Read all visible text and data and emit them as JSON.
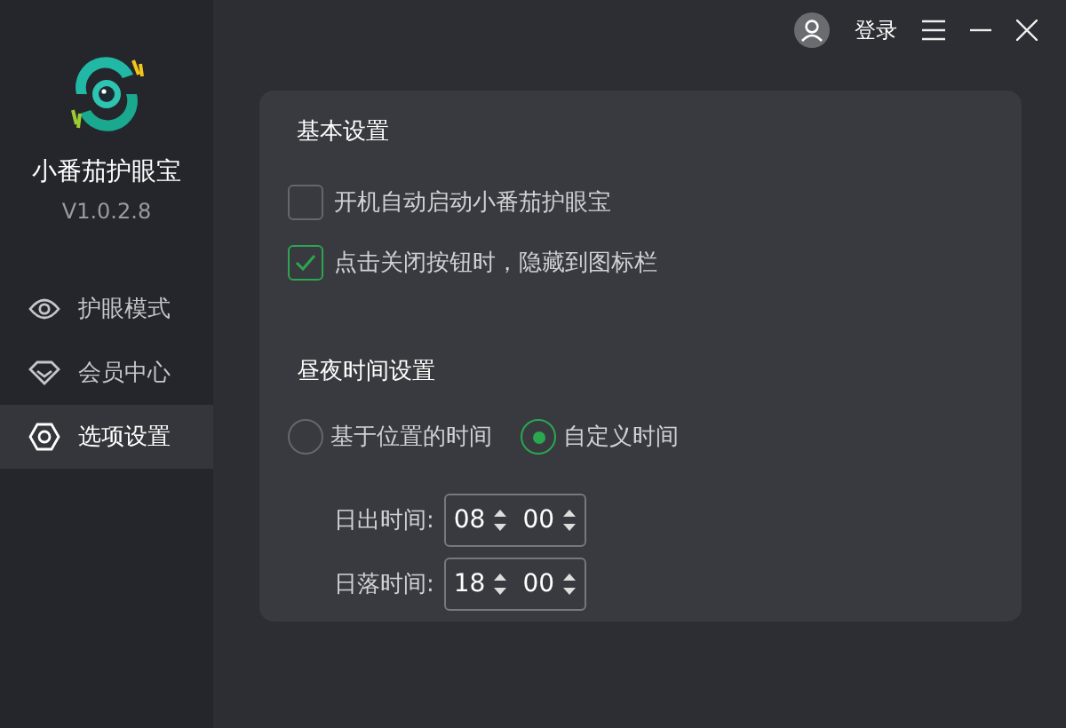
{
  "app": {
    "name": "小番茄护眼宝",
    "version": "V1.0.2.8"
  },
  "nav": [
    {
      "label": "护眼模式",
      "kind": "eye",
      "selected": false
    },
    {
      "label": "会员中心",
      "kind": "diamond",
      "selected": false
    },
    {
      "label": "选项设置",
      "kind": "gear",
      "selected": true
    }
  ],
  "header": {
    "login": "登录"
  },
  "basic": {
    "title": "基本设置",
    "options": [
      {
        "label": "开机自动启动小番茄护眼宝",
        "checked": false
      },
      {
        "label": "点击关闭按钮时，隐藏到图标栏",
        "checked": true
      }
    ]
  },
  "daynight": {
    "title": "昼夜时间设置",
    "modes": [
      {
        "label": "基于位置的时间",
        "selected": false
      },
      {
        "label": "自定义时间",
        "selected": true
      }
    ],
    "times": [
      {
        "label": "日出时间:",
        "hour": "08",
        "minute": "00"
      },
      {
        "label": "日落时间:",
        "hour": "18",
        "minute": "00"
      }
    ]
  }
}
